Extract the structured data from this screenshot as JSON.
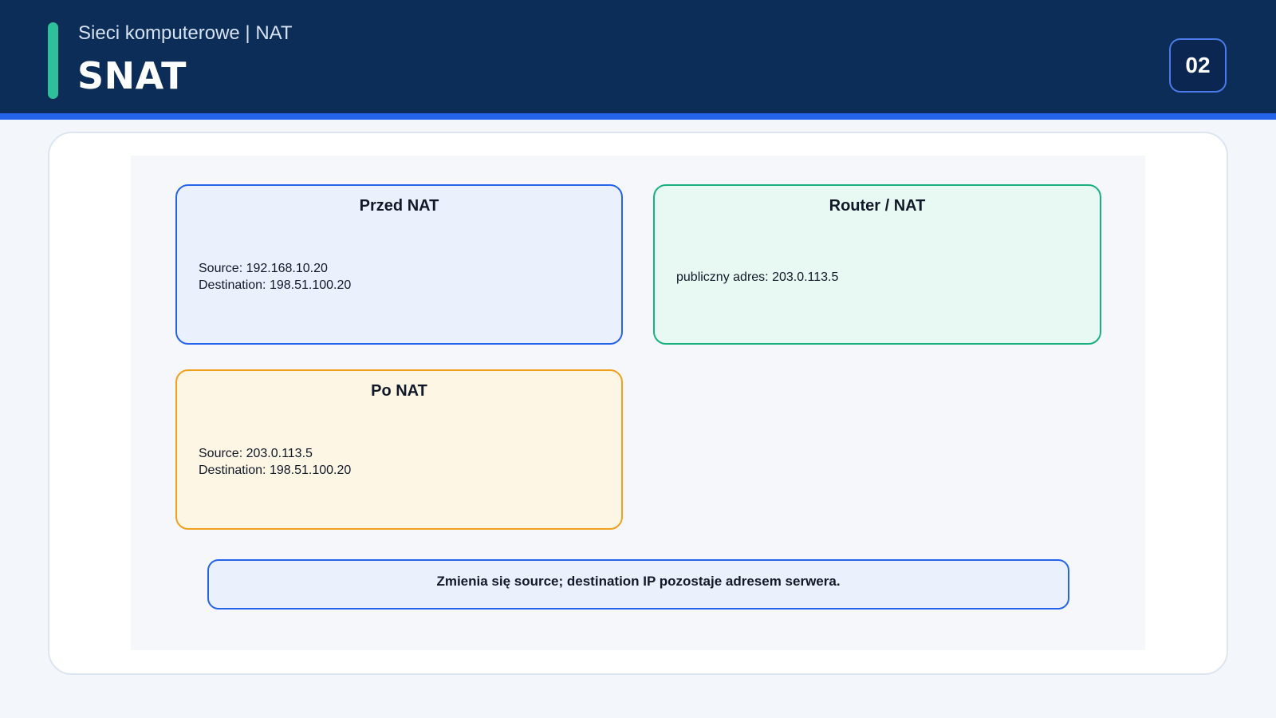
{
  "header": {
    "subtitle": "Sieci komputerowe | NAT",
    "title": "SNAT",
    "page_number": "02",
    "colors": {
      "background": "#0c2d57",
      "accent_bar": "#2fbf9b",
      "rule": "#2563eb"
    }
  },
  "diagram": {
    "before": {
      "title": "Przed NAT",
      "lines": [
        "Source: 192.168.10.20",
        "Destination: 198.51.100.20"
      ],
      "border_color": "#2563eb",
      "fill_color": "#eaf1fd"
    },
    "router": {
      "title": "Router / NAT",
      "lines": [
        "publiczny adres: 203.0.113.5"
      ],
      "border_color": "#19b07f",
      "fill_color": "#e8f8f2"
    },
    "after": {
      "title": "Po NAT",
      "lines": [
        "Source: 203.0.113.5",
        "Destination: 198.51.100.20"
      ],
      "border_color": "#f29f1c",
      "fill_color": "#fdf6e5"
    },
    "note": "Zmienia się source; destination IP pozostaje adresem serwera."
  }
}
